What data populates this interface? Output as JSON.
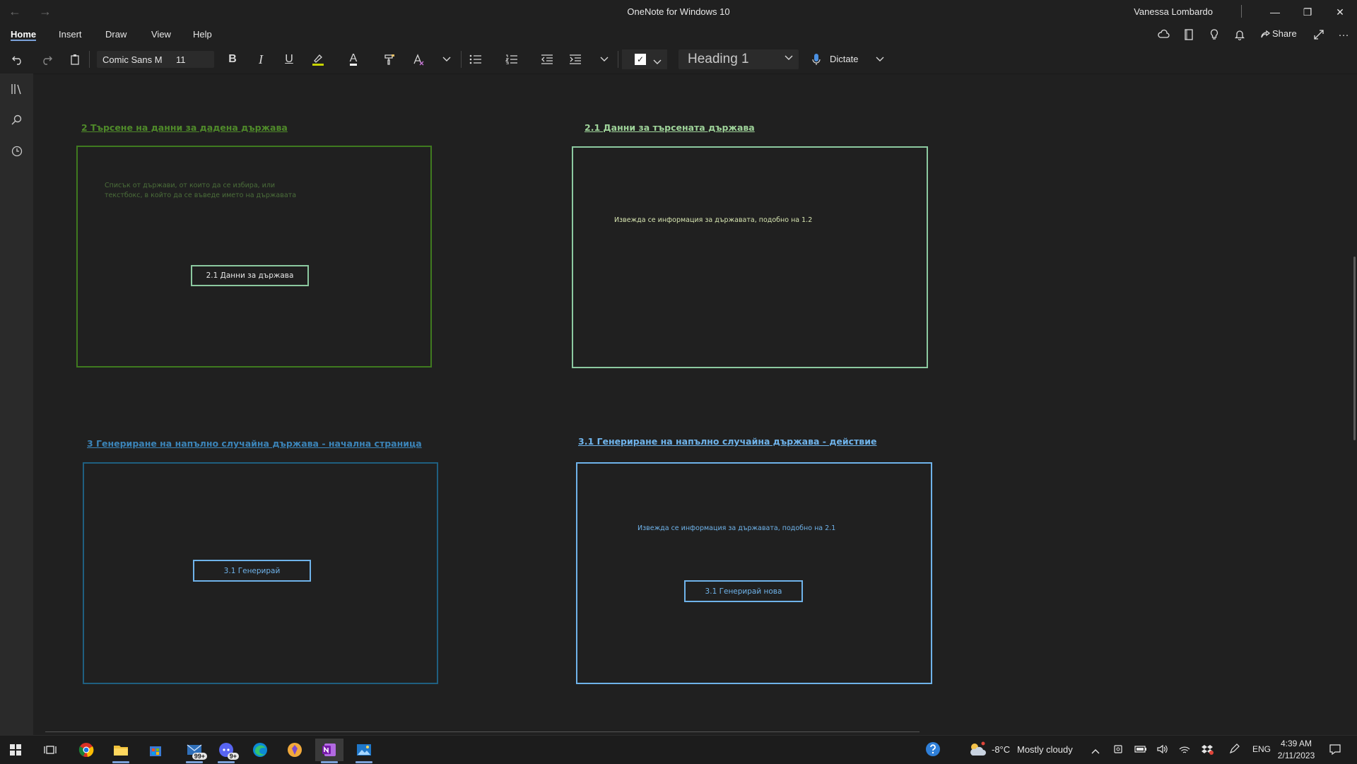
{
  "window": {
    "title": "OneNote for Windows 10",
    "user": "Vanessa Lombardo",
    "back_icon": "←",
    "forward_icon": "→",
    "minimize_icon": "—",
    "restore_icon": "❐",
    "close_icon": "✕"
  },
  "menu": {
    "items": [
      "Home",
      "Insert",
      "Draw",
      "View",
      "Help"
    ],
    "active": "Home",
    "share_label": "Share",
    "more_icon": "···"
  },
  "toolbar": {
    "font_name": "Comic Sans M",
    "font_size": "11",
    "bold": "B",
    "italic": "I",
    "underline": "U",
    "font_color_glyph": "A",
    "style": "Heading 1",
    "dictate": "Dictate",
    "todo_glyph": "✓"
  },
  "page": {
    "sections": [
      {
        "heading": "2 Търсене на данни за дадена държава",
        "color": "#4f8a2a",
        "note_lines": [
          "Списък от държави, от които да се избира, или",
          "текстбокс, в който да се въведе името на държавата"
        ],
        "button": "2.1 Данни за държава",
        "button_color": "#8cc9a0"
      },
      {
        "heading": "2.1 Данни за търсената държава",
        "color": "#9fd49a",
        "note_lines": [
          "Извежда се информация за държавата, подобно на 1.2"
        ]
      },
      {
        "heading": "3 Генериране на напълно случайна държава - начална страница",
        "color": "#3b84b8",
        "button": "3.1 Генерирай",
        "button_color": "#6fb3ea"
      },
      {
        "heading": "3.1 Генериране на напълно случайна държава - действие",
        "color": "#6fb3ea",
        "note_lines": [
          "Извежда се информация за държавата, подобно на 2.1"
        ],
        "button": "3.1 Генерирай нова",
        "button_color": "#6fb3ea"
      }
    ]
  },
  "taskbar": {
    "mail_badge": "99+",
    "discord_badge": "9+",
    "temperature": "-8°C",
    "weather": "Mostly cloudy",
    "language": "ENG",
    "time": "4:39 AM",
    "date": "2/11/2023"
  },
  "colors": {
    "background": "#202020",
    "accent": "#7aa0d8"
  }
}
